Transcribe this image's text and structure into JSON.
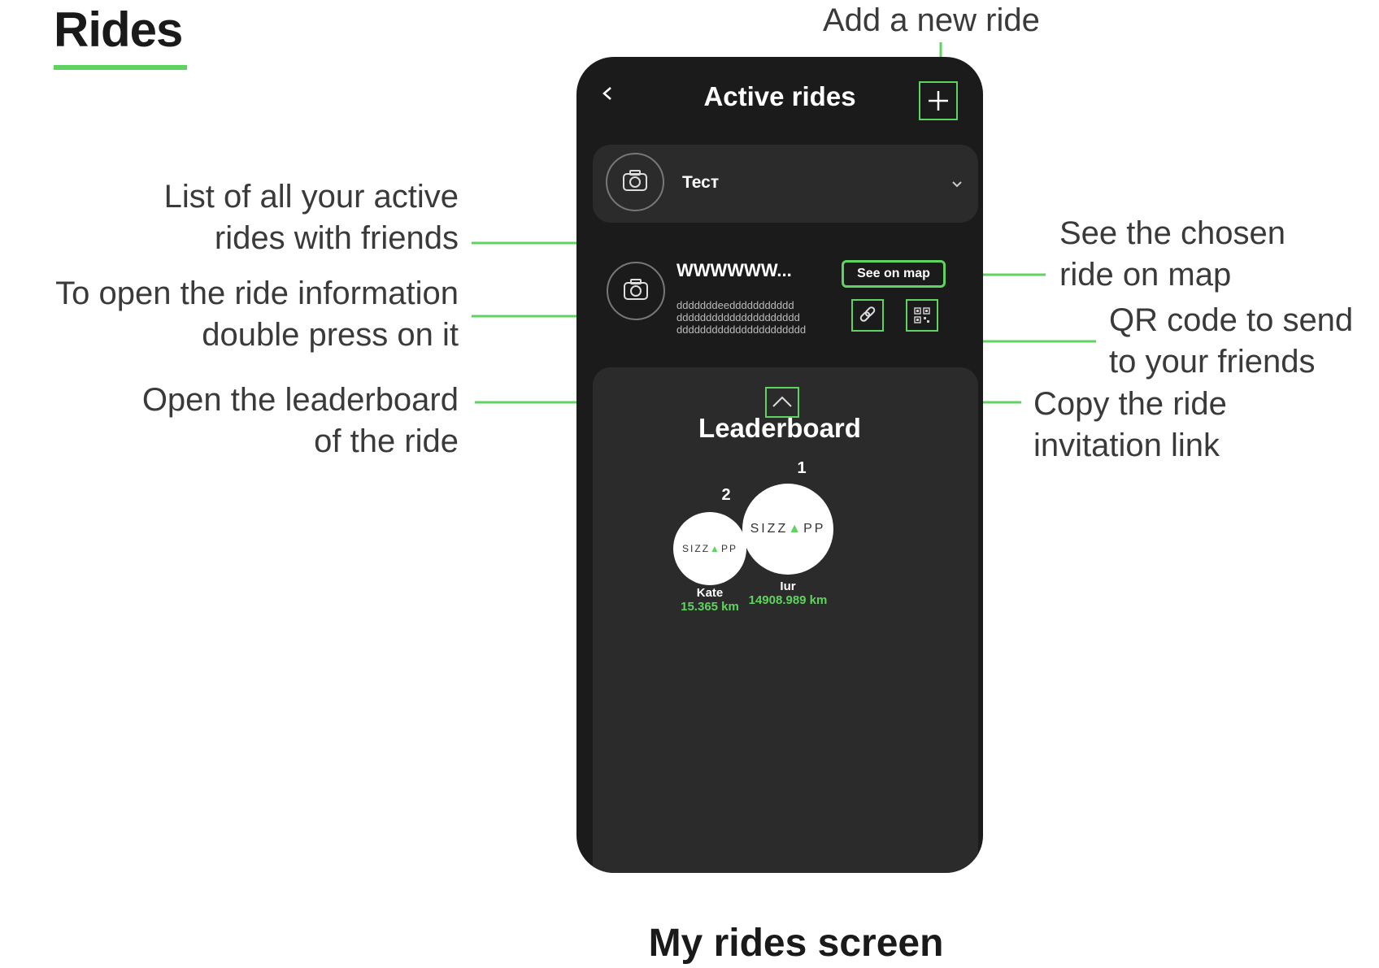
{
  "page": {
    "heading": "Rides",
    "footer_title": "My rides screen"
  },
  "annotations": {
    "add_ride": "Add a new ride",
    "list_line1": "List of all your active",
    "list_line2": "rides with friends",
    "open_line1": "To open the ride information",
    "open_line2": "double press on it",
    "leader_line1": "Open the leaderboard",
    "leader_line2": "of the ride",
    "map_line1": "See the chosen",
    "map_line2": "ride on map",
    "qr_line1": "QR code to send",
    "qr_line2": "to your friends",
    "copy_line1": "Copy the ride",
    "copy_line2": "invitation link"
  },
  "phone": {
    "title": "Active rides",
    "rides": [
      {
        "name": "Тест"
      },
      {
        "name": "WWWWWW...",
        "description_lines": [
          "dddddddeeddddddddddd",
          "ddddddddddddddddddddd",
          "dddddddddddddddddddddd"
        ],
        "see_on_map": "See on map"
      }
    ],
    "leaderboard": {
      "title": "Leaderboard",
      "entries": [
        {
          "rank": "1",
          "name": "Iur",
          "distance": "14908.989 km",
          "logo_a": "SIZZ",
          "logo_tri": "▲",
          "logo_b": "PP"
        },
        {
          "rank": "2",
          "name": "Kate",
          "distance": "15.365 km",
          "logo_a": "SIZZ",
          "logo_tri": "▲",
          "logo_b": "PP"
        }
      ]
    }
  },
  "colors": {
    "accent": "#5fd35f",
    "phone_bg": "#1b1b1b",
    "card_bg": "#2b2b2b"
  }
}
